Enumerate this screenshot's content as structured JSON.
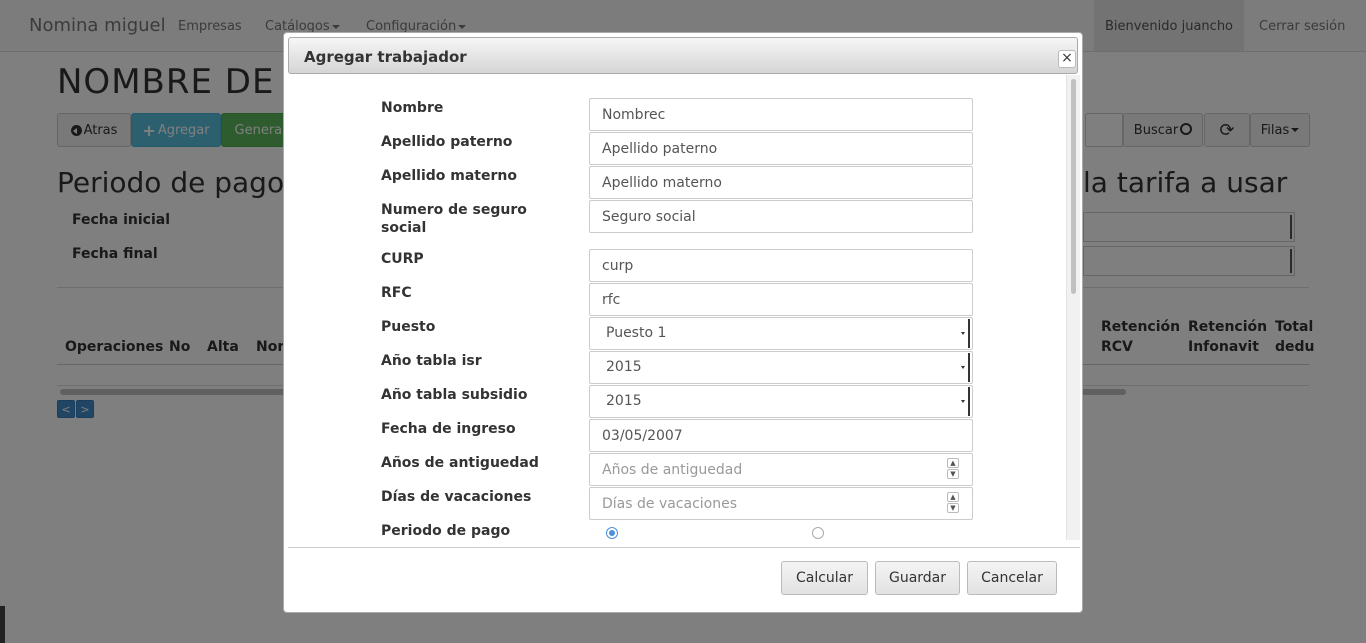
{
  "navbar": {
    "brand": "Nomina miguel",
    "items": [
      {
        "label": "Empresas"
      },
      {
        "label": "Catálogos"
      },
      {
        "label": "Configuración"
      }
    ],
    "welcome": "Bienvenido juancho",
    "logout": "Cerrar sesión"
  },
  "page": {
    "title": "NOMBRE DE",
    "buttons": {
      "back": "Atras",
      "add": "Agregar",
      "generate": "Generar",
      "search": "Buscar",
      "rows": "Filas"
    },
    "period_heading": "Periodo de pago",
    "start_date_label": "Fecha inicial",
    "end_date_label": "Fecha final",
    "tariff_heading": "la tarifa a usar",
    "table_headers": [
      "Operaciones",
      "No",
      "Alta",
      "Nor"
    ],
    "table_headers_right": [
      "Retención RCV",
      "Retención Infonavit",
      "Total dedu"
    ],
    "pager": {
      "prev": "<",
      "next": ">"
    }
  },
  "dialog": {
    "title": "Agregar trabajador",
    "close": "×",
    "fields": {
      "nombre": {
        "label": "Nombre",
        "value": "Nombrec"
      },
      "apellido_paterno": {
        "label": "Apellido paterno",
        "value": "Apellido paterno"
      },
      "apellido_materno": {
        "label": "Apellido materno",
        "value": "Apellido materno"
      },
      "seguro_social": {
        "label": "Numero de seguro social",
        "value": "Seguro social"
      },
      "curp": {
        "label": "CURP",
        "value": "curp"
      },
      "rfc": {
        "label": "RFC",
        "value": "rfc"
      },
      "puesto": {
        "label": "Puesto",
        "value": "Puesto 1"
      },
      "anio_isr": {
        "label": "Año tabla isr",
        "value": "2015"
      },
      "anio_subsidio": {
        "label": "Año tabla subsidio",
        "value": "2015"
      },
      "fecha_ingreso": {
        "label": "Fecha de ingreso",
        "value": "03/05/2007"
      },
      "antiguedad": {
        "label": "Años de antiguedad",
        "placeholder": "Años de antiguedad"
      },
      "vacaciones": {
        "label": "Días de vacaciones",
        "placeholder": "Días de vacaciones"
      },
      "periodo_pago": {
        "label": "Periodo de pago"
      }
    },
    "footer": {
      "calcular": "Calcular",
      "guardar": "Guardar",
      "cancelar": "Cancelar"
    }
  }
}
